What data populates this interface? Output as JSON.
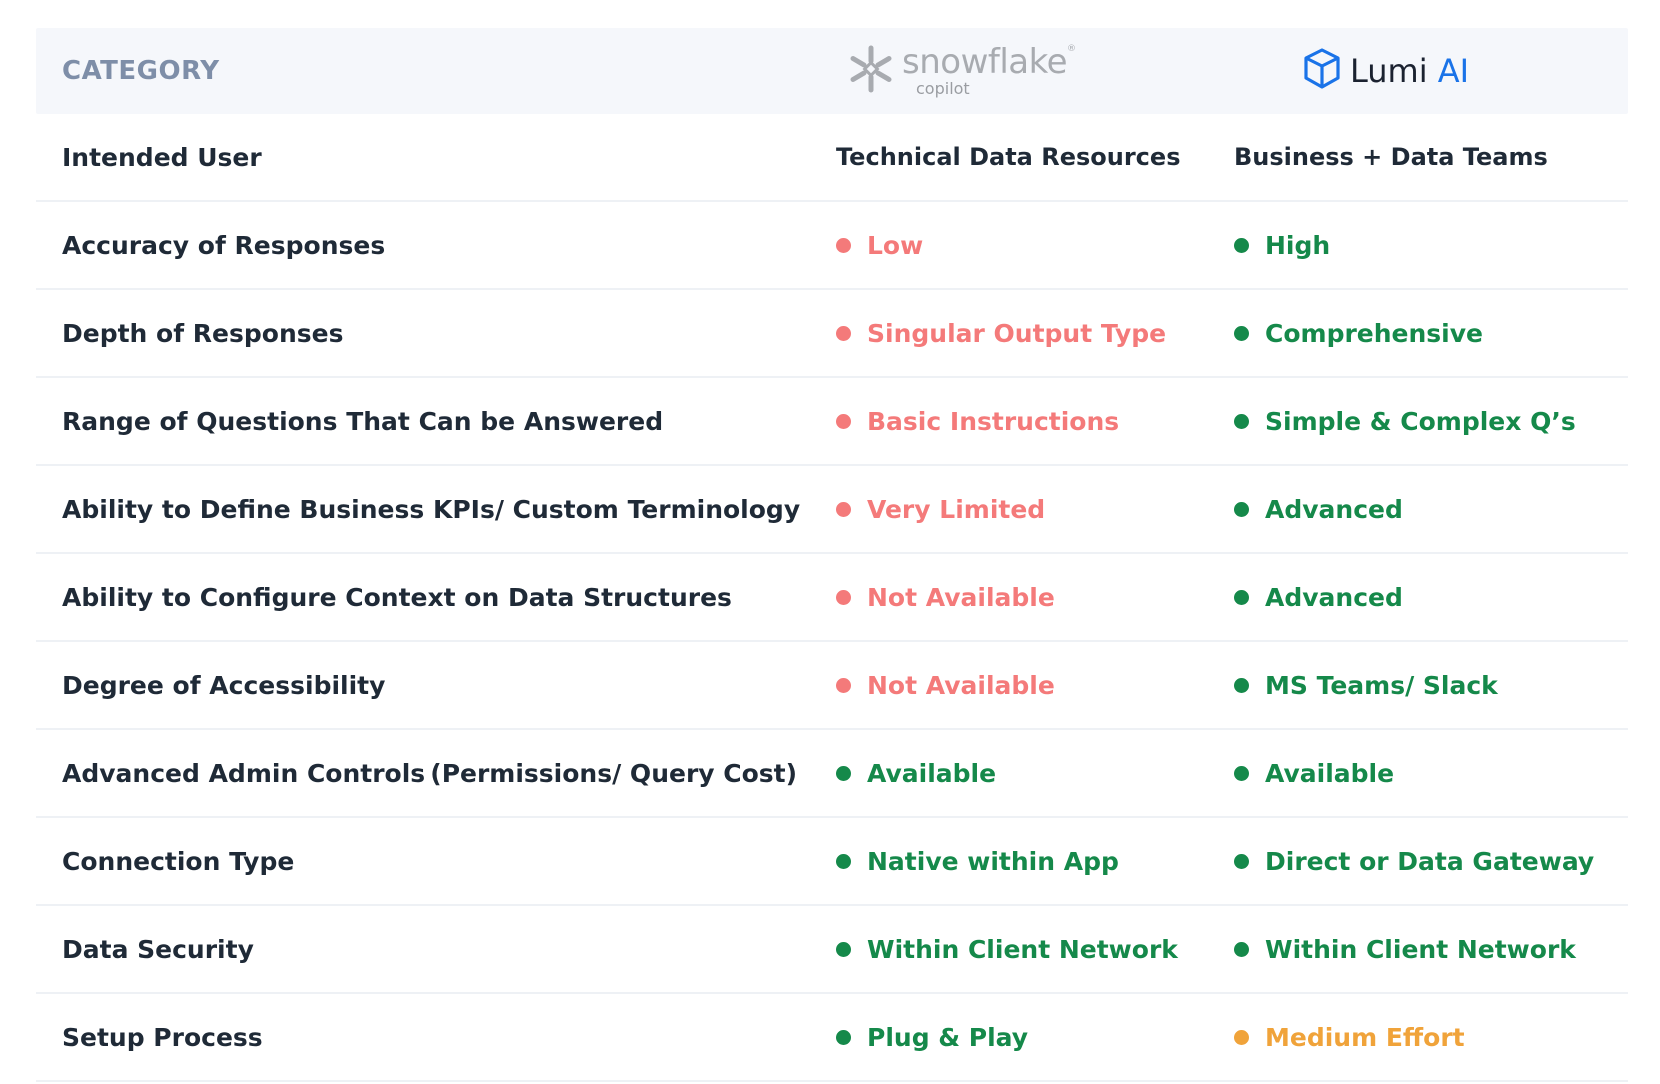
{
  "header": {
    "category_label": "CATEGORY",
    "snowflake_word": "snowflake",
    "snowflake_mark": "®",
    "snowflake_sub": "copilot",
    "lumi_word": "Lumi",
    "lumi_ai": "AI"
  },
  "colors": {
    "red": "#f47a7a",
    "green": "#15894a",
    "orange": "#f0a33a",
    "header_bg": "#f5f7fb",
    "category_gray": "#7e8ea8",
    "lumi_blue": "#1a73e8"
  },
  "icons": {
    "snowflake_logo": "snowflake-icon",
    "lumi_logo": "cube-icon",
    "status_dot": "dot-icon"
  },
  "rows": [
    {
      "category": "Intended User",
      "note": "",
      "snowflake": {
        "text": "Technical Data Resources",
        "status": "none"
      },
      "lumi": {
        "text": "Business + Data Teams",
        "status": "none"
      }
    },
    {
      "category": "Accuracy of Responses",
      "note": "",
      "snowflake": {
        "text": "Low",
        "status": "red"
      },
      "lumi": {
        "text": "High",
        "status": "green"
      }
    },
    {
      "category": "Depth of Responses",
      "note": "",
      "snowflake": {
        "text": "Singular Output Type",
        "status": "red"
      },
      "lumi": {
        "text": "Comprehensive",
        "status": "green"
      }
    },
    {
      "category": "Range of Questions That Can be Answered",
      "note": "",
      "snowflake": {
        "text": "Basic Instructions",
        "status": "red"
      },
      "lumi": {
        "text": "Simple & Complex Q’s",
        "status": "green"
      }
    },
    {
      "category": "Ability to Define Business KPIs/ Custom Terminology",
      "note": "",
      "snowflake": {
        "text": "Very Limited",
        "status": "red"
      },
      "lumi": {
        "text": "Advanced",
        "status": "green"
      }
    },
    {
      "category": "Ability to Configure Context on Data Structures",
      "note": "",
      "snowflake": {
        "text": "Not Available",
        "status": "red"
      },
      "lumi": {
        "text": "Advanced",
        "status": "green"
      }
    },
    {
      "category": "Degree of Accessibility",
      "note": "",
      "snowflake": {
        "text": "Not Available",
        "status": "red"
      },
      "lumi": {
        "text": "MS Teams/ Slack",
        "status": "green"
      }
    },
    {
      "category": "Advanced Admin Controls",
      "note": "(Permissions/ Query Cost)",
      "snowflake": {
        "text": "Available",
        "status": "green"
      },
      "lumi": {
        "text": "Available",
        "status": "green"
      }
    },
    {
      "category": "Connection Type",
      "note": "",
      "snowflake": {
        "text": "Native within App",
        "status": "green"
      },
      "lumi": {
        "text": "Direct or Data Gateway",
        "status": "green"
      }
    },
    {
      "category": "Data Security",
      "note": "",
      "snowflake": {
        "text": "Within Client  Network",
        "status": "green"
      },
      "lumi": {
        "text": "Within Client  Network",
        "status": "green"
      }
    },
    {
      "category": "Setup Process",
      "note": "",
      "snowflake": {
        "text": "Plug & Play",
        "status": "green"
      },
      "lumi": {
        "text": "Medium Effort",
        "status": "orange"
      }
    }
  ]
}
